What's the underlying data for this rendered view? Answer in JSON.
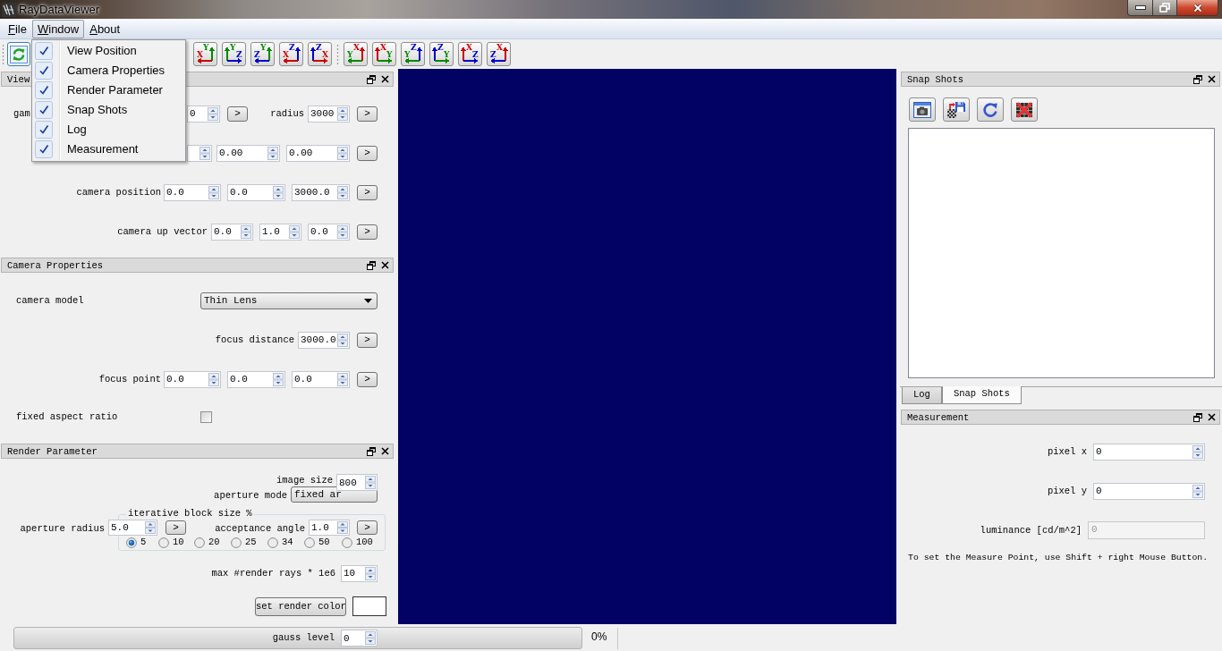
{
  "window": {
    "title": "RayDataViewer"
  },
  "menu_bar": [
    {
      "label": "File",
      "open": false
    },
    {
      "label": "Window",
      "open": true
    },
    {
      "label": "About",
      "open": false
    }
  ],
  "window_menu": [
    {
      "label": "View Position",
      "checked": true
    },
    {
      "label": "Camera Properties",
      "checked": true
    },
    {
      "label": "Render Parameter",
      "checked": true
    },
    {
      "label": "Snap Shots",
      "checked": true
    },
    {
      "label": "Log",
      "checked": true
    },
    {
      "label": "Measurement",
      "checked": true
    }
  ],
  "toolbar": {
    "view_groups": [
      [
        {
          "kind": "right",
          "h": {
            "label": "X",
            "color": "#cc0000"
          },
          "v": {
            "label": "Y",
            "color": "#008800"
          }
        },
        {
          "kind": "left",
          "h": {
            "label": "Z",
            "color": "#0000cc"
          },
          "v": {
            "label": "Y",
            "color": "#008800"
          }
        },
        {
          "kind": "right",
          "h": {
            "label": "Z",
            "color": "#0000cc"
          },
          "v": {
            "label": "Y",
            "color": "#008800"
          }
        },
        {
          "kind": "right",
          "h": {
            "label": "X",
            "color": "#cc0000"
          },
          "v": {
            "label": "Z",
            "color": "#0000cc"
          }
        },
        {
          "kind": "left",
          "h": {
            "label": "X",
            "color": "#cc0000"
          },
          "v": {
            "label": "Z",
            "color": "#0000cc"
          }
        }
      ],
      [
        {
          "kind": "right",
          "h": {
            "label": "Y",
            "color": "#008800"
          },
          "v": {
            "label": "X",
            "color": "#cc0000"
          }
        },
        {
          "kind": "left",
          "h": {
            "label": "Y",
            "color": "#008800"
          },
          "v": {
            "label": "X",
            "color": "#cc0000"
          }
        },
        {
          "kind": "right",
          "h": {
            "label": "Y",
            "color": "#008800"
          },
          "v": {
            "label": "Z",
            "color": "#0000cc"
          }
        },
        {
          "kind": "left",
          "h": {
            "label": "Y",
            "color": "#008800"
          },
          "v": {
            "label": "Z",
            "color": "#0000cc"
          }
        },
        {
          "kind": "left",
          "h": {
            "label": "Z",
            "color": "#0000cc"
          },
          "v": {
            "label": "X",
            "color": "#cc0000"
          }
        },
        {
          "kind": "right",
          "h": {
            "label": "Z",
            "color": "#0000cc"
          },
          "v": {
            "label": "X",
            "color": "#cc0000"
          }
        }
      ]
    ]
  },
  "view_position": {
    "title": "View",
    "rows": [
      {
        "items": [
          {
            "kind": "label",
            "text": "gam"
          },
          {
            "kind": "spin",
            "value": "0"
          },
          {
            "kind": "apply",
            "text": ">"
          },
          {
            "kind": "label",
            "text": "radius"
          },
          {
            "kind": "spin",
            "value": "3000"
          },
          {
            "kind": "apply",
            "text": ">"
          }
        ]
      },
      {
        "items": [
          {
            "kind": "spin"
          },
          {
            "kind": "spin",
            "value": "0.00"
          },
          {
            "kind": "spin",
            "value": "0.00"
          },
          {
            "kind": "apply",
            "text": ">"
          }
        ]
      },
      {
        "items": [
          {
            "kind": "label",
            "text": "camera position"
          },
          {
            "kind": "spin",
            "value": "0.0"
          },
          {
            "kind": "spin",
            "value": "0.0"
          },
          {
            "kind": "spin",
            "value": "3000.0"
          },
          {
            "kind": "apply",
            "text": ">"
          }
        ]
      },
      {
        "items": [
          {
            "kind": "label",
            "text": "camera up vector"
          },
          {
            "kind": "spin",
            "value": "0.0"
          },
          {
            "kind": "spin",
            "value": "1.0"
          },
          {
            "kind": "spin",
            "value": "0.0"
          },
          {
            "kind": "apply",
            "text": ">"
          }
        ]
      }
    ]
  },
  "camera_properties": {
    "title": "Camera Properties",
    "rows": [
      {
        "items": [
          {
            "kind": "label",
            "text": "camera model"
          },
          {
            "kind": "combo",
            "value": "Thin Lens"
          }
        ]
      },
      {
        "items": [
          {
            "kind": "label",
            "text": "focus distance"
          },
          {
            "kind": "spin",
            "value": "3000.0"
          },
          {
            "kind": "apply",
            "text": ">"
          }
        ]
      },
      {
        "items": [
          {
            "kind": "label",
            "text": "focus point"
          },
          {
            "kind": "spin",
            "value": "0.0"
          },
          {
            "kind": "spin",
            "value": "0.0"
          },
          {
            "kind": "spin",
            "value": "0.0"
          },
          {
            "kind": "apply",
            "text": ">"
          }
        ]
      },
      {
        "items": [
          {
            "kind": "label",
            "text": "fixed aspect ratio"
          },
          {
            "kind": "check",
            "checked": false
          }
        ]
      }
    ]
  },
  "render_parameter": {
    "title": "Render Parameter",
    "image_size": {
      "label": "image size",
      "value": "800"
    },
    "aperture_mode": {
      "label": "aperture mode",
      "value": "fixed ar"
    },
    "block_size": {
      "title": "iterative block size %",
      "options": [
        {
          "label": "5",
          "selected": true
        },
        {
          "label": "10",
          "selected": false
        },
        {
          "label": "20",
          "selected": false
        },
        {
          "label": "25",
          "selected": false
        },
        {
          "label": "34",
          "selected": false
        },
        {
          "label": "50",
          "selected": false
        },
        {
          "label": "100",
          "selected": false
        }
      ]
    },
    "aperture_radius": {
      "label": "aperture radius",
      "value": "5.0",
      "apply": ">"
    },
    "acceptance_angle": {
      "label": "acceptance angle",
      "value": "1.0",
      "apply": ">"
    },
    "max_rays": {
      "label": "max #render rays * 1e6",
      "value": "10"
    },
    "render_color": {
      "button": "set render color",
      "color": "#ffffff"
    }
  },
  "snap_shots": {
    "title": "Snap Shots"
  },
  "right_tabs": [
    {
      "label": "Log",
      "selected": false
    },
    {
      "label": "Snap Shots",
      "selected": true
    }
  ],
  "measurement": {
    "title": "Measurement",
    "fields": [
      {
        "kind": "spin",
        "label": "pixel x",
        "value": "0",
        "disabled": false
      },
      {
        "kind": "spin",
        "label": "pixel y",
        "value": "0",
        "disabled": false
      },
      {
        "kind": "text",
        "label": "luminance [cd/m^2]",
        "value": "0",
        "disabled": true
      }
    ],
    "note": "To set the Measure Point, use Shift + right Mouse Button."
  },
  "status_bar": {
    "progress": {
      "reading": "0%"
    },
    "gauss_level": {
      "label": "gauss level",
      "value": "0"
    }
  }
}
